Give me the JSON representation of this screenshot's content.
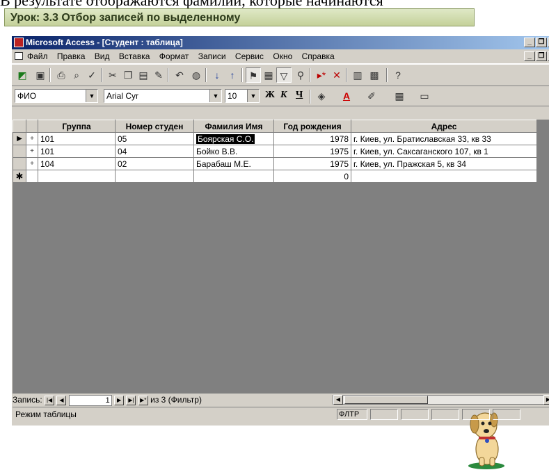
{
  "document": {
    "top_text": "В результате отображаются фамилии, которые начинаются"
  },
  "lesson": {
    "title": "Урок: 3.3 Отбор записей по выделенному"
  },
  "window": {
    "title": "Microsoft Access - [Студент : таблица]",
    "buttons": {
      "minimize": "_",
      "restore": "❐",
      "close": "×"
    }
  },
  "menu": {
    "items": [
      "Файл",
      "Правка",
      "Вид",
      "Вставка",
      "Формат",
      "Записи",
      "Сервис",
      "Окно",
      "Справка"
    ]
  },
  "format_bar": {
    "field": "ФИО",
    "font": "Arial Cyr",
    "size": "10",
    "bold": "Ж",
    "italic": "К",
    "underline": "Ч"
  },
  "table": {
    "columns": [
      "Группа",
      "Номер студен",
      "Фамилия Имя",
      "Год рождения",
      "Адрес"
    ],
    "rows": [
      {
        "group": "101",
        "num": "05",
        "name": "Боярская С.О.",
        "year": "1978",
        "addr": "г. Киев, ул. Братиславская 33, кв 33"
      },
      {
        "group": "101",
        "num": "04",
        "name": "Бойко В.В.",
        "year": "1975",
        "addr": "г. Киев, ул. Саксаганского 107, кв 1"
      },
      {
        "group": "104",
        "num": "02",
        "name": "Барабаш М.Е.",
        "year": "1975",
        "addr": "г. Киев, ул. Пражская 5, кв 34"
      }
    ],
    "new_row": {
      "year": "0"
    }
  },
  "navigation": {
    "label": "Запись:",
    "current": "1",
    "total_text": "из 3 (Фильтр)"
  },
  "status": {
    "mode": "Режим таблицы",
    "flag": "ФЛТР"
  }
}
